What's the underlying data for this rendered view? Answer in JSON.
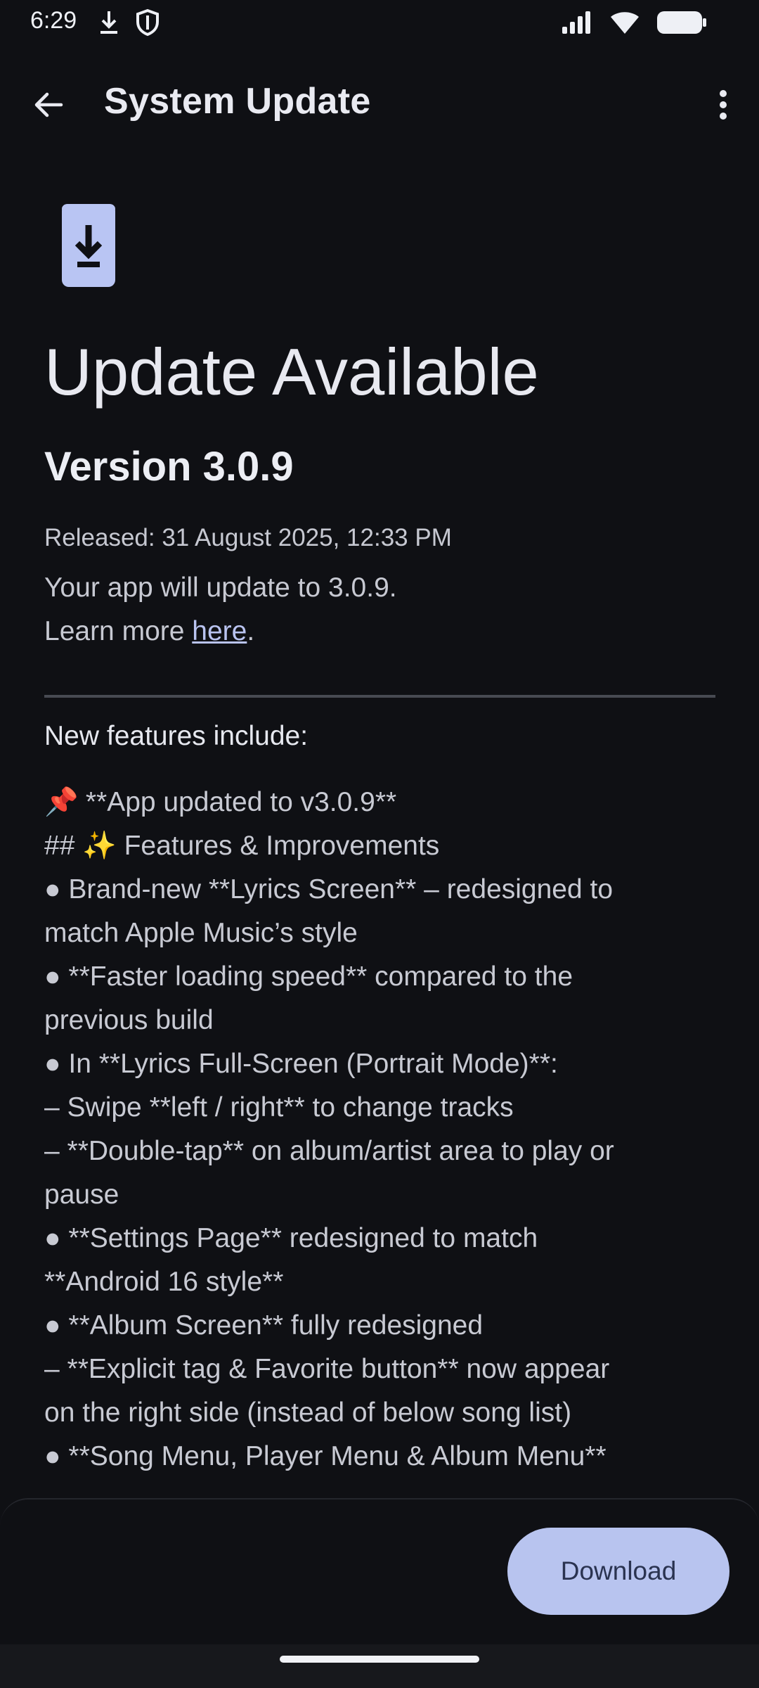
{
  "status_bar": {
    "time": "6:29"
  },
  "app_bar": {
    "title": "System Update"
  },
  "update": {
    "headline": "Update Available",
    "version": "Version 3.0.9",
    "released": "Released: 31 August 2025, 12:33 PM",
    "desc_line1": "Your app will update to 3.0.9.",
    "desc_line2_prefix": "Learn more ",
    "desc_link": "here",
    "desc_line2_suffix": "."
  },
  "features": {
    "heading": "New features include:",
    "pin_emoji": "📌",
    "lines": [
      " **App updated to v3.0.9**",
      "## ✨ Features & Improvements",
      "● Brand-new **Lyrics Screen** – redesigned to",
      "match Apple Music’s style",
      "● **Faster loading speed** compared to the",
      "previous build",
      "● In **Lyrics Full-Screen (Portrait Mode)**:",
      "– Swipe **left / right** to change tracks",
      "– **Double-tap** on album/artist area to play or",
      "pause",
      "● **Settings Page** redesigned to match",
      "**Android 16 style**",
      "● **Album Screen** fully redesigned",
      "– **Explicit tag & Favorite button** now appear",
      "on the right side (instead of below song list)",
      "● **Song Menu, Player Menu & Album Menu**"
    ]
  },
  "actions": {
    "download_label": "Download"
  },
  "colors": {
    "background": "#0f1014",
    "accent": "#b8c4ef",
    "icon_accent": "#b9c5f3"
  }
}
